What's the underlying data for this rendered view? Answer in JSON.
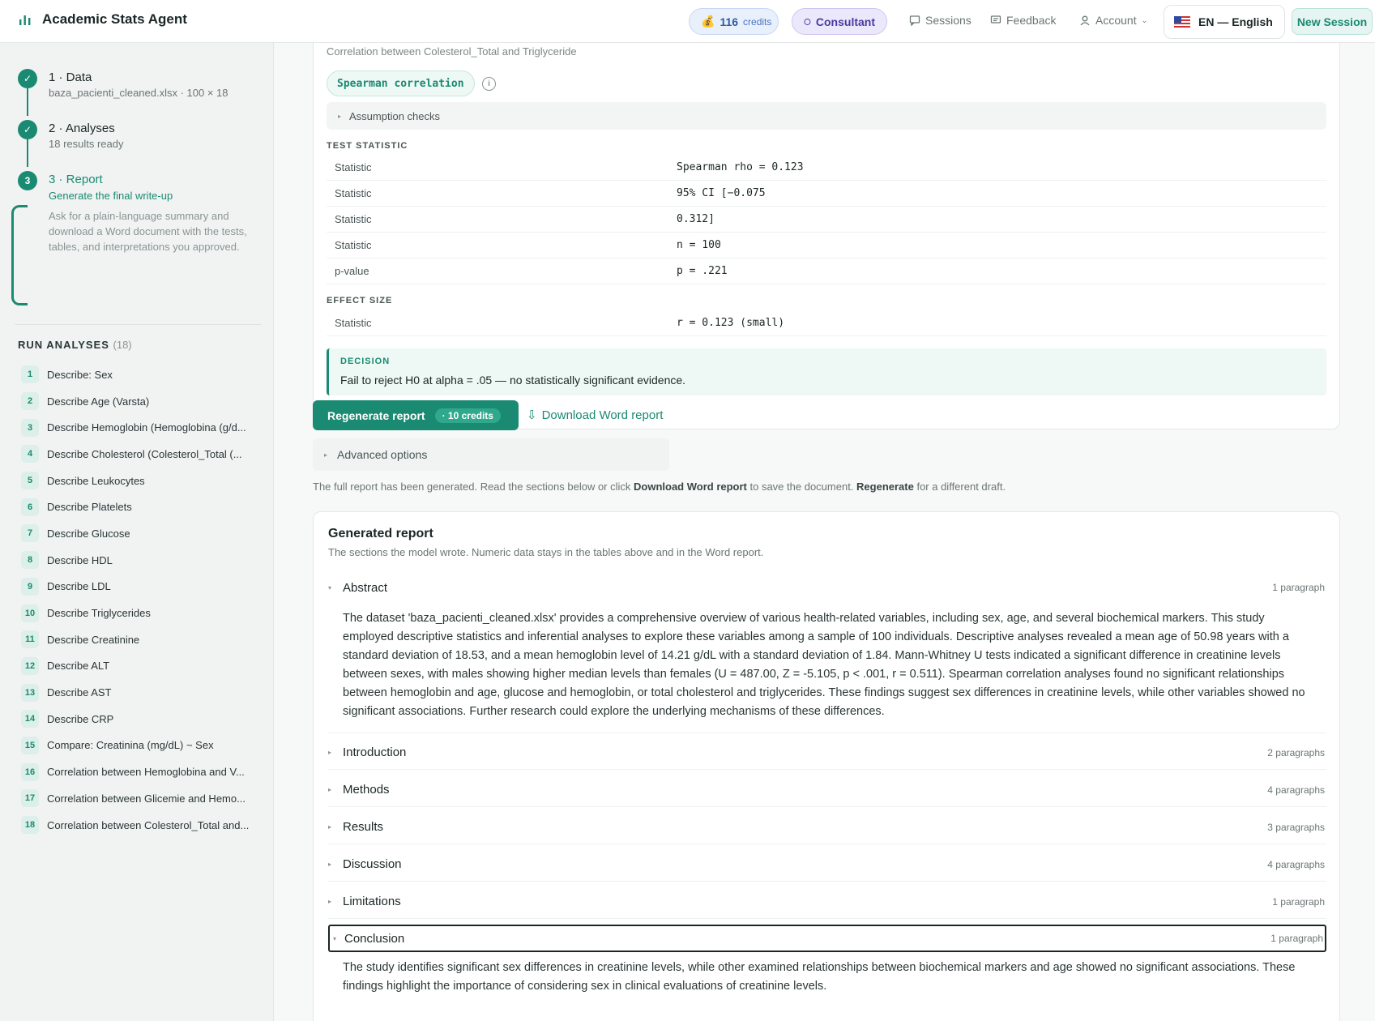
{
  "app": {
    "title": "Academic Stats Agent"
  },
  "header": {
    "credits_value": "116",
    "credits_unit": "credits",
    "consultant": "Consultant",
    "sessions": "Sessions",
    "feedback": "Feedback",
    "account": "Account",
    "language": "EN — English",
    "new_session": "New Session"
  },
  "steps": [
    {
      "num": "1",
      "title": "1 · Data",
      "sub": "baza_pacienti_cleaned.xlsx · 100 × 18"
    },
    {
      "num": "2",
      "title": "2 · Analyses",
      "sub": "18 results ready"
    },
    {
      "num": "3",
      "title": "3 · Report",
      "sub": "Generate the final write-up",
      "desc": "Ask for a plain-language summary and download a Word document with the tests, tables, and interpretations you approved."
    }
  ],
  "run": {
    "heading": "RUN ANALYSES",
    "count": "(18)",
    "items": [
      {
        "n": "1",
        "label": "Describe: Sex"
      },
      {
        "n": "2",
        "label": "Describe Age (Varsta)"
      },
      {
        "n": "3",
        "label": "Describe Hemoglobin (Hemoglobina (g/d..."
      },
      {
        "n": "4",
        "label": "Describe Cholesterol (Colesterol_Total (..."
      },
      {
        "n": "5",
        "label": "Describe Leukocytes"
      },
      {
        "n": "6",
        "label": "Describe Platelets"
      },
      {
        "n": "7",
        "label": "Describe Glucose"
      },
      {
        "n": "8",
        "label": "Describe HDL"
      },
      {
        "n": "9",
        "label": "Describe LDL"
      },
      {
        "n": "10",
        "label": "Describe Triglycerides"
      },
      {
        "n": "11",
        "label": "Describe Creatinine"
      },
      {
        "n": "12",
        "label": "Describe ALT"
      },
      {
        "n": "13",
        "label": "Describe AST"
      },
      {
        "n": "14",
        "label": "Describe CRP"
      },
      {
        "n": "15",
        "label": "Compare: Creatinina (mg/dL) ~ Sex"
      },
      {
        "n": "16",
        "label": "Correlation between Hemoglobina and V..."
      },
      {
        "n": "17",
        "label": "Correlation between Glicemie and Hemo..."
      },
      {
        "n": "18",
        "label": "Correlation between Colesterol_Total and..."
      }
    ]
  },
  "result": {
    "cut_title": "Correlation between Colesterol_Total and Triglyceride",
    "test_chip": "Spearman correlation",
    "assumption": "Assumption checks",
    "test_stat_label": "TEST STATISTIC",
    "rows": [
      {
        "name": "Statistic",
        "value": "Spearman rho = 0.123"
      },
      {
        "name": "Statistic",
        "value": "95% CI [−0.075"
      },
      {
        "name": "Statistic",
        "value": "0.312]"
      },
      {
        "name": "Statistic",
        "value": "n = 100"
      },
      {
        "name": "p-value",
        "value": "p = .221"
      }
    ],
    "effect_label": "EFFECT SIZE",
    "effect_row": {
      "name": "Statistic",
      "value": "r = 0.123 (small)"
    },
    "decision_label": "DECISION",
    "decision_text": "Fail to reject H0 at alpha = .05 — no statistically significant evidence."
  },
  "actions": {
    "regenerate": "Regenerate report",
    "regen_cost": "· 10 credits",
    "download": "Download Word report",
    "advanced": "Advanced options",
    "note_a": "The full report has been generated. Read the sections below or click ",
    "note_b": "Download Word report",
    "note_c": " to save the document. ",
    "note_d": "Regenerate",
    "note_e": " for a different draft."
  },
  "report": {
    "title": "Generated report",
    "subtitle": "The sections the model wrote. Numeric data stays in the tables above and in the Word report.",
    "sections": [
      {
        "title": "Abstract",
        "count": "1 paragraph",
        "body": "The dataset 'baza_pacienti_cleaned.xlsx' provides a comprehensive overview of various health-related variables, including sex, age, and several biochemical markers. This study employed descriptive statistics and inferential analyses to explore these variables among a sample of 100 individuals. Descriptive analyses revealed a mean age of 50.98 years with a standard deviation of 18.53, and a mean hemoglobin level of 14.21 g/dL with a standard deviation of 1.84. Mann-Whitney U tests indicated a significant difference in creatinine levels between sexes, with males showing higher median levels than females (U = 487.00, Z = -5.105, p < .001, r = 0.511). Spearman correlation analyses found no significant relationships between hemoglobin and age, glucose and hemoglobin, or total cholesterol and triglycerides. These findings suggest sex differences in creatinine levels, while other variables showed no significant associations. Further research could explore the underlying mechanisms of these differences."
      },
      {
        "title": "Introduction",
        "count": "2 paragraphs"
      },
      {
        "title": "Methods",
        "count": "4 paragraphs"
      },
      {
        "title": "Results",
        "count": "3 paragraphs"
      },
      {
        "title": "Discussion",
        "count": "4 paragraphs"
      },
      {
        "title": "Limitations",
        "count": "1 paragraph"
      },
      {
        "title": "Conclusion",
        "count": "1 paragraph",
        "body": "The study identifies significant sex differences in creatinine levels, while other examined relationships between biochemical markers and age showed no significant associations. These findings highlight the importance of considering sex in clinical evaluations of creatinine levels."
      }
    ]
  },
  "colors": {
    "accent": "#1a8a72",
    "credits": "#2f5aa8",
    "consultant": "#4a3aa0"
  }
}
